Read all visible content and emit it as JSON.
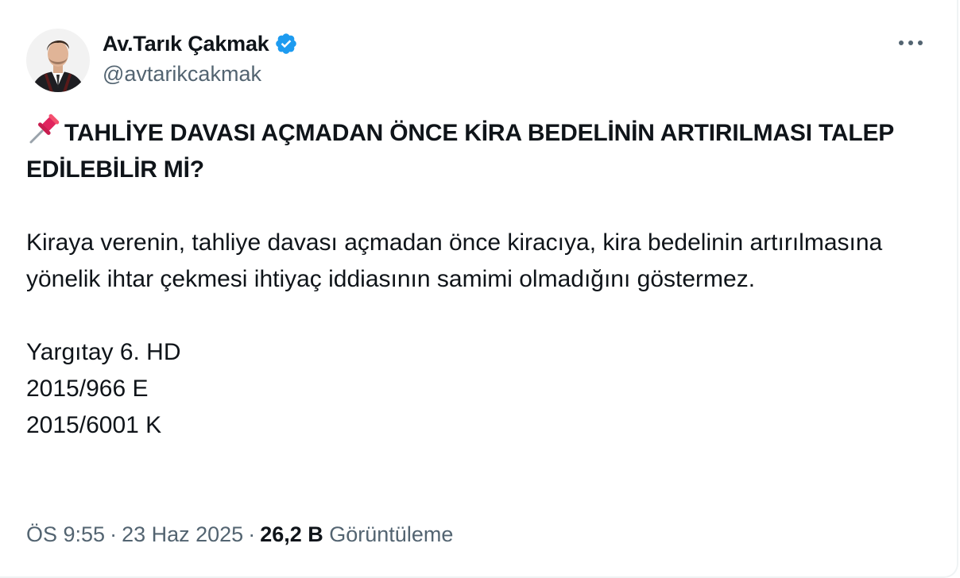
{
  "author": {
    "display_name": "Av.Tarık Çakmak",
    "handle": "@avtarikcakmak",
    "verified": true,
    "verified_color": "#1d9bf0"
  },
  "more_icon": "more-horizontal-icon",
  "tweet": {
    "emoji": "pushpin-icon",
    "headline": "TAHLİYE DAVASI AÇMADAN ÖNCE KİRA BEDELİNİN ARTIRILMASI TALEP EDİLEBİLİR Mİ?",
    "body": "Kiraya verenin, tahliye davası açmadan önce kiracıya, kira bedelinin artırılmasına yönelik ihtar çekmesi ihtiyaç iddiasının samimi olmadığını göstermez.",
    "citation": {
      "court": "Yargıtay 6. HD",
      "esas": "2015/966 E",
      "karar": "2015/6001 K"
    }
  },
  "meta": {
    "time": "ÖS 9:55",
    "date": "23 Haz 2025",
    "views_count": "26,2 B",
    "views_label": "Görüntüleme"
  }
}
